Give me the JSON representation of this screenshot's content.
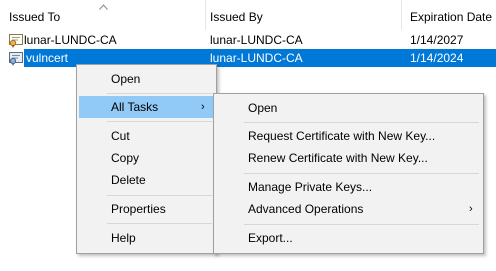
{
  "columns": {
    "issued_to": "Issued To",
    "issued_by": "Issued By",
    "expiration_date": "Expiration Date"
  },
  "rows": [
    {
      "issued_to": "lunar-LUNDC-CA",
      "issued_by": "lunar-LUNDC-CA",
      "expiration": "1/14/2027",
      "icon": "certificate-icon"
    },
    {
      "issued_to": "vulncert",
      "issued_by": "lunar-LUNDC-CA",
      "expiration": "1/14/2024",
      "icon": "certificate-icon",
      "selected": true
    }
  ],
  "context_menu": {
    "open": "Open",
    "all_tasks": "All Tasks",
    "cut": "Cut",
    "copy": "Copy",
    "delete": "Delete",
    "properties": "Properties",
    "help": "Help"
  },
  "submenu": {
    "open": "Open",
    "request_new_key": "Request Certificate with New Key...",
    "renew_new_key": "Renew Certificate with New Key...",
    "manage_private_keys": "Manage Private Keys...",
    "advanced_operations": "Advanced Operations",
    "export": "Export..."
  },
  "icons": {
    "sort": "sort-ascending-icon",
    "submenu_arrow": "chevron-right-icon"
  },
  "colors": {
    "selection": "#0078d7",
    "menu_highlight": "#91c9f7",
    "menu_background": "#f2f2f2"
  }
}
